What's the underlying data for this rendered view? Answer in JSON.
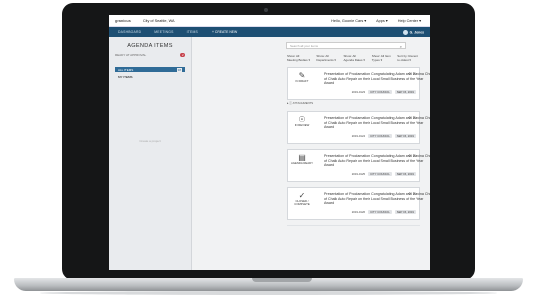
{
  "app": {
    "logo": "granicus",
    "city": "City of Seattle, WA",
    "top_links": [
      "Hello, Goonie Cars ▾",
      "Apps ▾",
      "Help Center ▾"
    ]
  },
  "nav": {
    "items": [
      "DASHBOARD",
      "MEETINGS",
      "ITEMS"
    ],
    "create": "+ CREATE NEW",
    "user": "G. Jones"
  },
  "sidebar": {
    "title": "AGENDA ITEMS",
    "approval_label": "READY AT APPROVAL",
    "approval_count": "2",
    "all_items_label": "ALL ITEMS",
    "all_items_count": "38",
    "my_items_label": "MY ITEMS",
    "empty_text": "Create a project"
  },
  "main": {
    "search_placeholder": "Search all your items",
    "filters": [
      "Show: All Meeting Bodies ▾",
      "Show: All Departments ▾",
      "Show: All Agenda Dates ▾",
      "Show: All Item Types ▾"
    ],
    "sort_label": "Sort by: Recent to oldest ▾",
    "attachments_label": "▸ ⓘ ATTACHMENTS"
  },
  "cards": [
    {
      "status": "IN DRAFT",
      "icon": "draft-icon",
      "title": "Presentation of Proclamation Congratulating Adam and Davina Chef of Chalk Auto Repair on their Local Small Business of the Year Award",
      "id": "2019-0123",
      "body": "CITY COUNCIL",
      "date": "SEP 15, 2019"
    },
    {
      "status": "IN REVIEW",
      "icon": "review-icon",
      "title": "Presentation of Proclamation Congratulating Adam and Davina Chef of Chalk Auto Repair on their Local Small Business of the Year Award",
      "id": "2019-0124",
      "body": "CITY COUNCIL",
      "date": "SEP 15, 2019"
    },
    {
      "status": "AGENDA READY",
      "icon": "agenda-ready-icon",
      "title": "Presentation of Proclamation Congratulating Adam and Davina Chef of Chalk Auto Repair on their Local Small Business of the Year Award",
      "id": "2019-0125",
      "body": "CITY COUNCIL",
      "date": "SEP 15, 2019"
    },
    {
      "status": "CLOSED / COMPLETE",
      "icon": "checkmark-icon",
      "title": "Presentation of Proclamation Congratulating Adam and Davina Chef of Chalk Auto Repair on their Local Small Business of the Year Award",
      "id": "2019-0126",
      "body": "CITY COUNCIL",
      "date": "SEP 15, 2019"
    }
  ]
}
